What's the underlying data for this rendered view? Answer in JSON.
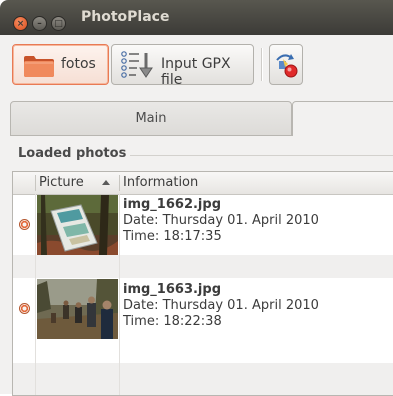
{
  "window": {
    "title": "PhotoPlace"
  },
  "toolbar": {
    "photos_label": "fotos",
    "gpx_label": "Input GPX file"
  },
  "tabs": {
    "main": "Main"
  },
  "panel": {
    "title": "Loaded photos"
  },
  "table": {
    "columns": [
      "Picture",
      "Information"
    ],
    "rows": [
      {
        "filename": "img_1662.jpg",
        "date": "Date: Thursday 01. April 2010",
        "time": "Time: 18:17:35",
        "icon": "photo-thumbnail-map-sign"
      },
      {
        "filename": "img_1663.jpg",
        "date": "Date: Thursday 01. April 2010",
        "time": "Time: 18:22:38",
        "icon": "photo-thumbnail-hikers"
      }
    ]
  },
  "colors": {
    "accent": "#e87a55",
    "titlebar": "#3c3b37",
    "window_bg": "#f2f1f0"
  }
}
